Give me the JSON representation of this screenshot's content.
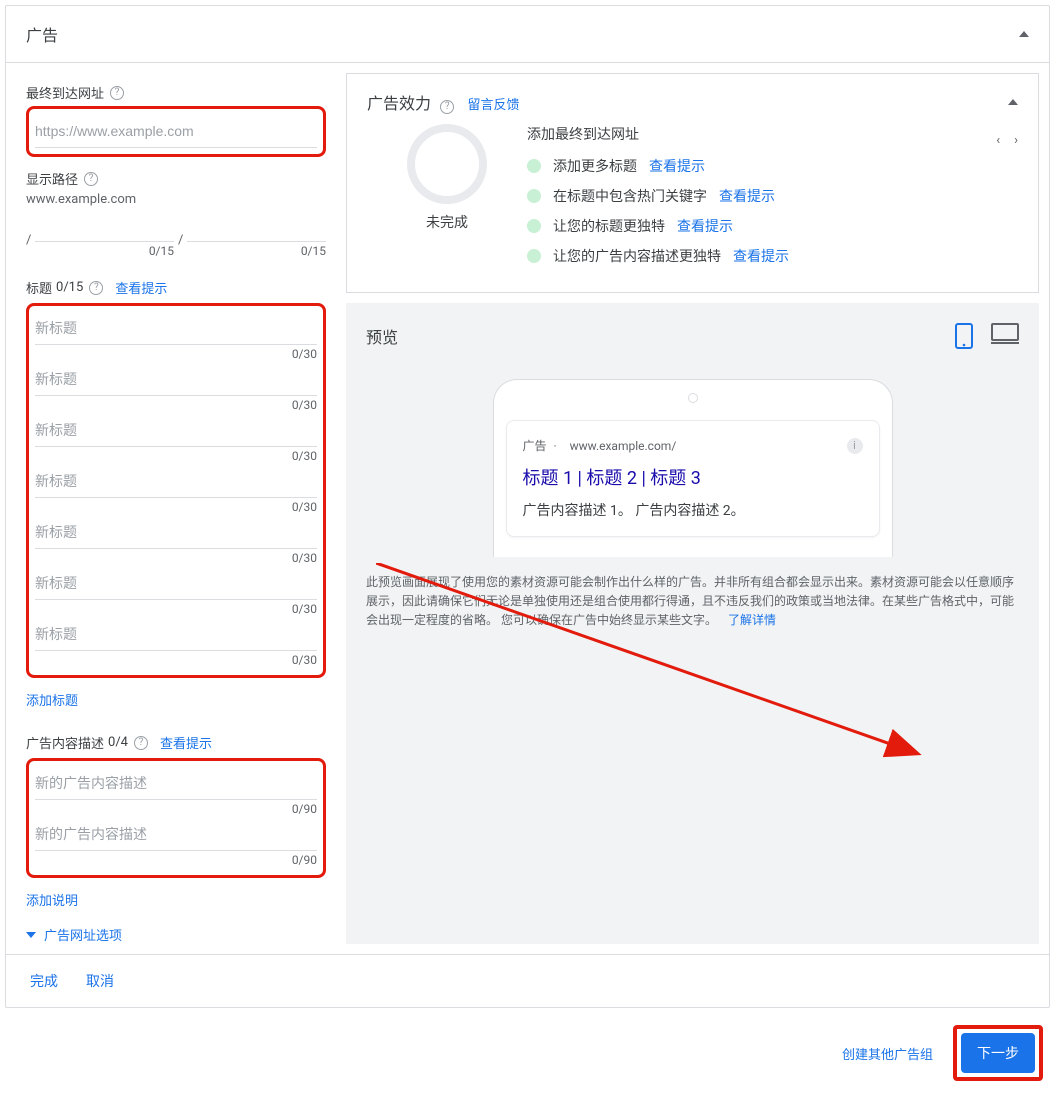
{
  "header": {
    "title": "广告"
  },
  "url": {
    "label": "最终到达网址",
    "placeholder": "https://www.example.com"
  },
  "path": {
    "label": "显示路径",
    "domain": "www.example.com",
    "counter1": "0/15",
    "counter2": "0/15"
  },
  "headlines": {
    "label_prefix": "标题",
    "count": "0/15",
    "hint_link": "查看提示",
    "placeholder": "新标题",
    "counter": "0/30",
    "add": "添加标题",
    "rows": 7
  },
  "descriptions": {
    "label_prefix": "广告内容描述",
    "count": "0/4",
    "hint_link": "查看提示",
    "placeholder": "新的广告内容描述",
    "counter": "0/90",
    "add": "添加说明",
    "rows": 2
  },
  "url_options": "广告网址选项",
  "strength": {
    "title": "广告效力",
    "feedback_link": "留言反馈",
    "status": "未完成",
    "current_suggestion": "添加最终到达网址",
    "suggestions": [
      {
        "text": "添加更多标题",
        "link": "查看提示"
      },
      {
        "text": "在标题中包含热门关键字",
        "link": "查看提示"
      },
      {
        "text": "让您的标题更独特",
        "link": "查看提示"
      },
      {
        "text": "让您的广告内容描述更独特",
        "link": "查看提示"
      }
    ]
  },
  "preview": {
    "title": "预览",
    "ad_badge": "广告",
    "dot": "·",
    "ad_url": "www.example.com/",
    "ad_headline": "标题 1 | 标题 2 | 标题 3",
    "ad_desc": "广告内容描述 1。 广告内容描述 2。",
    "disclaimer": "此预览画面展现了使用您的素材资源可能会制作出什么样的广告。并非所有组合都会显示出来。素材资源可能会以任意顺序展示，因此请确保它们无论是单独使用还是组合使用都行得通，且不违反我们的政策或当地法律。在某些广告格式中，可能会出现一定程度的省略。 您可以确保在广告中始终显示某些文字。",
    "learn_more": "了解详情"
  },
  "footer": {
    "done": "完成",
    "cancel": "取消"
  },
  "bottom": {
    "create_another": "创建其他广告组",
    "next": "下一步"
  }
}
